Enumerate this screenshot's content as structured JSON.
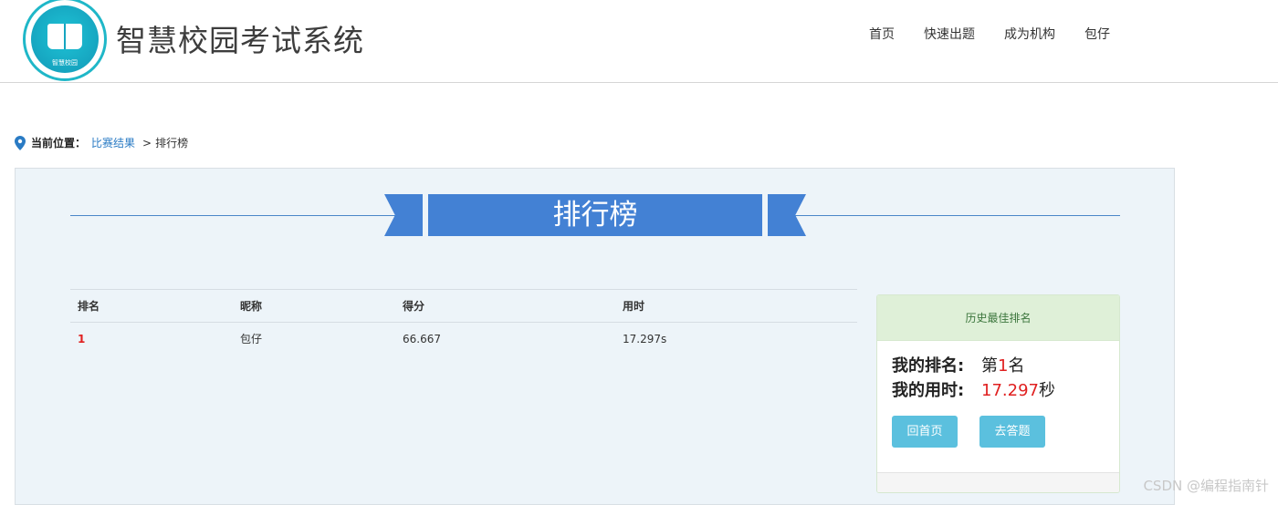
{
  "header": {
    "site_title": "智慧校园考试系统",
    "logo_text": "智慧校园",
    "nav": [
      "首页",
      "快速出题",
      "成为机构",
      "包仔"
    ]
  },
  "breadcrumb": {
    "label": "当前位置：",
    "link": "比赛结果",
    "separator": ">",
    "current": "排行榜"
  },
  "ribbon": {
    "title": "排行榜"
  },
  "table": {
    "headers": [
      "排名",
      "昵称",
      "得分",
      "用时"
    ],
    "rows": [
      {
        "rank": "1",
        "nickname": "包仔",
        "score": "66.667",
        "time": "17.297s"
      }
    ]
  },
  "card": {
    "title": "历史最佳排名",
    "rank_label": "我的排名:",
    "rank_prefix": "第",
    "rank_value": "1",
    "rank_suffix": "名",
    "time_label": "我的用时:",
    "time_value": "17.297",
    "time_suffix": "秒",
    "btn_home": "回首页",
    "btn_answer": "去答题"
  },
  "colors": {
    "accent": "#4381d4",
    "rank_red": "#e02020",
    "button": "#5bc0de",
    "card_head": "#dff0d8"
  },
  "watermark": "CSDN @编程指南针"
}
